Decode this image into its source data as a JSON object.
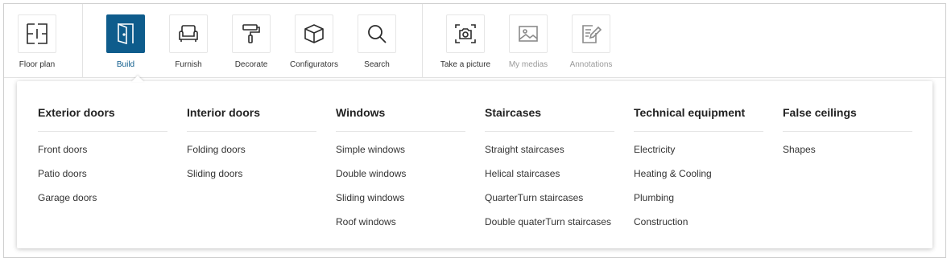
{
  "toolbar": {
    "tools": [
      {
        "id": "floor-plan",
        "label": "Floor plan",
        "icon": "floor-plan-icon",
        "state": "normal"
      },
      {
        "id": "build",
        "label": "Build",
        "icon": "door-icon",
        "state": "active"
      },
      {
        "id": "furnish",
        "label": "Furnish",
        "icon": "armchair-icon",
        "state": "normal"
      },
      {
        "id": "decorate",
        "label": "Decorate",
        "icon": "paint-roller-icon",
        "state": "normal"
      },
      {
        "id": "configurators",
        "label": "Configurators",
        "icon": "cube-icon",
        "state": "normal"
      },
      {
        "id": "search",
        "label": "Search",
        "icon": "search-icon",
        "state": "normal"
      },
      {
        "id": "take-a-picture",
        "label": "Take a picture",
        "icon": "camera-icon",
        "state": "normal"
      },
      {
        "id": "my-medias",
        "label": "My medias",
        "icon": "image-icon",
        "state": "disabled"
      },
      {
        "id": "annotations",
        "label": "Annotations",
        "icon": "annotation-icon",
        "state": "disabled"
      }
    ]
  },
  "menu": {
    "columns": [
      {
        "title": "Exterior doors",
        "items": [
          "Front doors",
          "Patio doors",
          "Garage doors"
        ]
      },
      {
        "title": "Interior doors",
        "items": [
          "Folding doors",
          "Sliding doors"
        ]
      },
      {
        "title": "Windows",
        "items": [
          "Simple windows",
          "Double windows",
          "Sliding windows",
          "Roof windows"
        ]
      },
      {
        "title": "Staircases",
        "items": [
          "Straight staircases",
          "Helical staircases",
          "QuarterTurn staircases",
          "Double quaterTurn staircases"
        ]
      },
      {
        "title": "Technical equipment",
        "items": [
          "Electricity",
          "Heating & Cooling",
          "Plumbing",
          "Construction"
        ]
      },
      {
        "title": "False ceilings",
        "items": [
          "Shapes"
        ]
      }
    ]
  },
  "colors": {
    "accent": "#0e5c8c",
    "text": "#333333",
    "disabled": "#9a9a9a",
    "border": "#cfcfcf"
  }
}
